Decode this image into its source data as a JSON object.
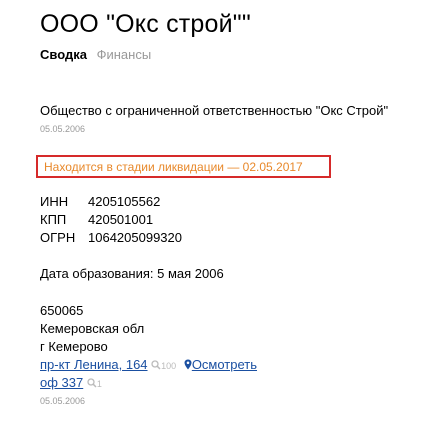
{
  "page": {
    "title": "ООО \"Окс строй\"\"",
    "tabs": [
      {
        "label": "Сводка",
        "active": true
      },
      {
        "label": "Финансы",
        "active": false
      }
    ]
  },
  "company": {
    "full_name": "Общество с ограниченной ответственностью \"Окс Строй\"",
    "full_name_date": "05.05.2006",
    "liquidation_status": "Находится в стадии ликвидации — 02.05.2017"
  },
  "requisites": [
    {
      "label": "ИНН",
      "value": "4205105562"
    },
    {
      "label": "КПП",
      "value": "420501001"
    },
    {
      "label": "ОГРН",
      "value": "1064205099320"
    }
  ],
  "registration": {
    "text": "Дата образования: 5 мая 2006"
  },
  "address": {
    "postcode": "650065",
    "region": "Кемеровская обл",
    "city": "г Кемерово",
    "street_link": "пр-кт Ленина, 164",
    "street_count": "100",
    "view_link": "Осмотреть",
    "office_link": "оф 337",
    "office_count": "1",
    "date": "05.05.2006"
  },
  "colors": {
    "link": "#1a4fa1",
    "liquidation_text": "#e8882a",
    "highlight_border": "#d62a2a",
    "muted": "#999999"
  }
}
